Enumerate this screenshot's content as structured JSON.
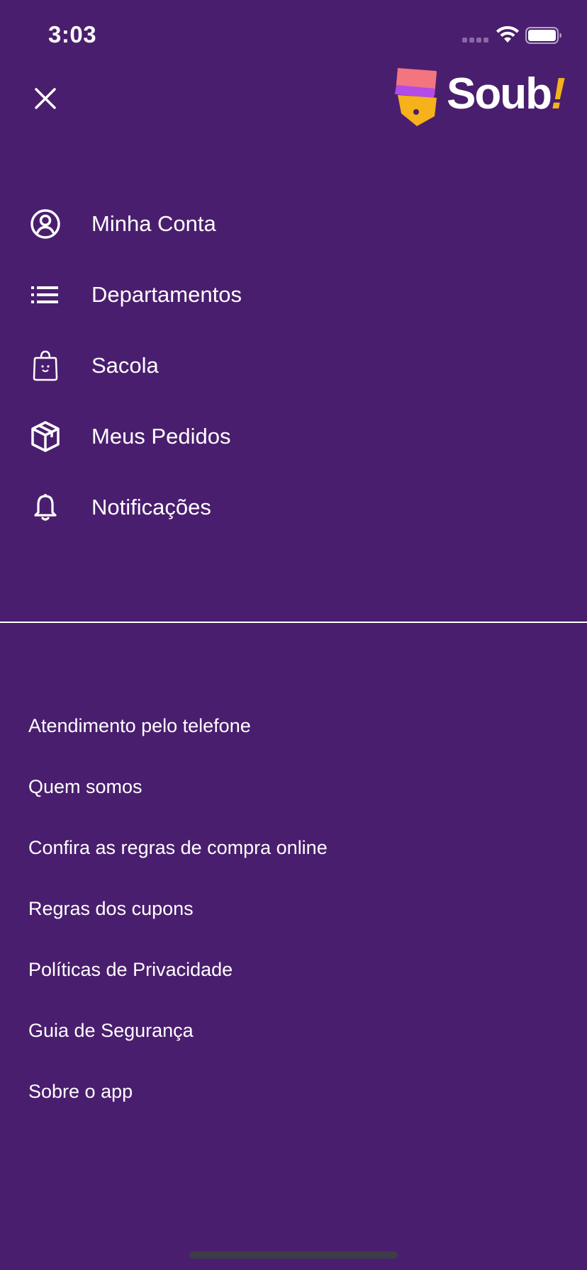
{
  "status_bar": {
    "time": "3:03"
  },
  "header": {
    "brand_name": "Soub",
    "brand_suffix": "!",
    "brand_colors": {
      "background": "#4a1e6e",
      "accent_yellow": "#f5b21a",
      "accent_pink": "#f27580",
      "accent_purple": "#b24be8"
    }
  },
  "primary_menu": [
    {
      "label": "Minha Conta",
      "icon": "account-icon"
    },
    {
      "label": "Departamentos",
      "icon": "list-icon"
    },
    {
      "label": "Sacola",
      "icon": "bag-icon"
    },
    {
      "label": "Meus Pedidos",
      "icon": "box-icon"
    },
    {
      "label": "Notificações",
      "icon": "bell-icon"
    }
  ],
  "secondary_menu": [
    {
      "label": "Atendimento pelo telefone"
    },
    {
      "label": "Quem somos"
    },
    {
      "label": "Confira as regras de compra online"
    },
    {
      "label": "Regras dos cupons"
    },
    {
      "label": "Políticas de Privacidade"
    },
    {
      "label": "Guia de Segurança"
    },
    {
      "label": "Sobre o app"
    }
  ]
}
